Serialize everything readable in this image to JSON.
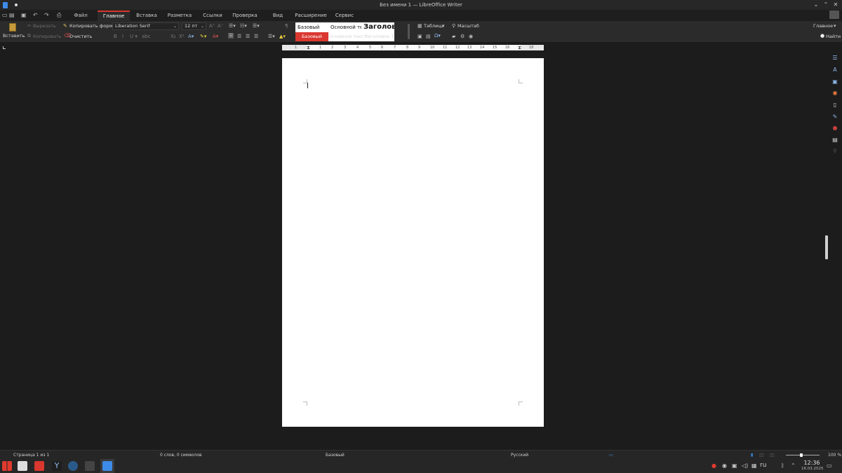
{
  "window": {
    "title": "Без имени 1 — LibreOffice Writer"
  },
  "tabs": [
    "Файл",
    "Главное",
    "Вставка",
    "Разметка",
    "Ссылки",
    "Проверка",
    "Вид",
    "Расширение",
    "Сервис"
  ],
  "active_tab": "Главное",
  "ribbon": {
    "paste_label": "Вставить",
    "cut_label": "Вырезать",
    "copy_label": "Копировать",
    "clone_label": "Копировать формат",
    "clear_label": "Очистить",
    "font_name": "Liberation Serif",
    "font_size": "12 пт",
    "styles": {
      "row1": [
        "Базовый",
        "Основной текст",
        "Заголовок"
      ],
      "row2": [
        "Базовый",
        "Основной текст",
        "Заголовок 1"
      ],
      "selected": "Базовый"
    },
    "table_label": "Таблица",
    "zoom_label": "Масштаб",
    "mode_label": "Главное",
    "find_label": "Найти"
  },
  "ruler": {
    "numbers": [
      "1",
      "1",
      "2",
      "3",
      "4",
      "5",
      "6",
      "7",
      "8",
      "9",
      "10",
      "11",
      "12",
      "13",
      "14",
      "15",
      "16",
      "18"
    ]
  },
  "status": {
    "page": "Страница 1 из 1",
    "words": "0 слов, 0 символов",
    "style": "Базовый",
    "language": "Русский",
    "zoom": "100 %"
  },
  "taskbar": {
    "time": "12:36",
    "date": "16.03.2025",
    "lang": "ru"
  },
  "colors": {
    "accent": "#d9372f",
    "background": "#1c1c1c",
    "ribbon": "#2b2b2b"
  }
}
